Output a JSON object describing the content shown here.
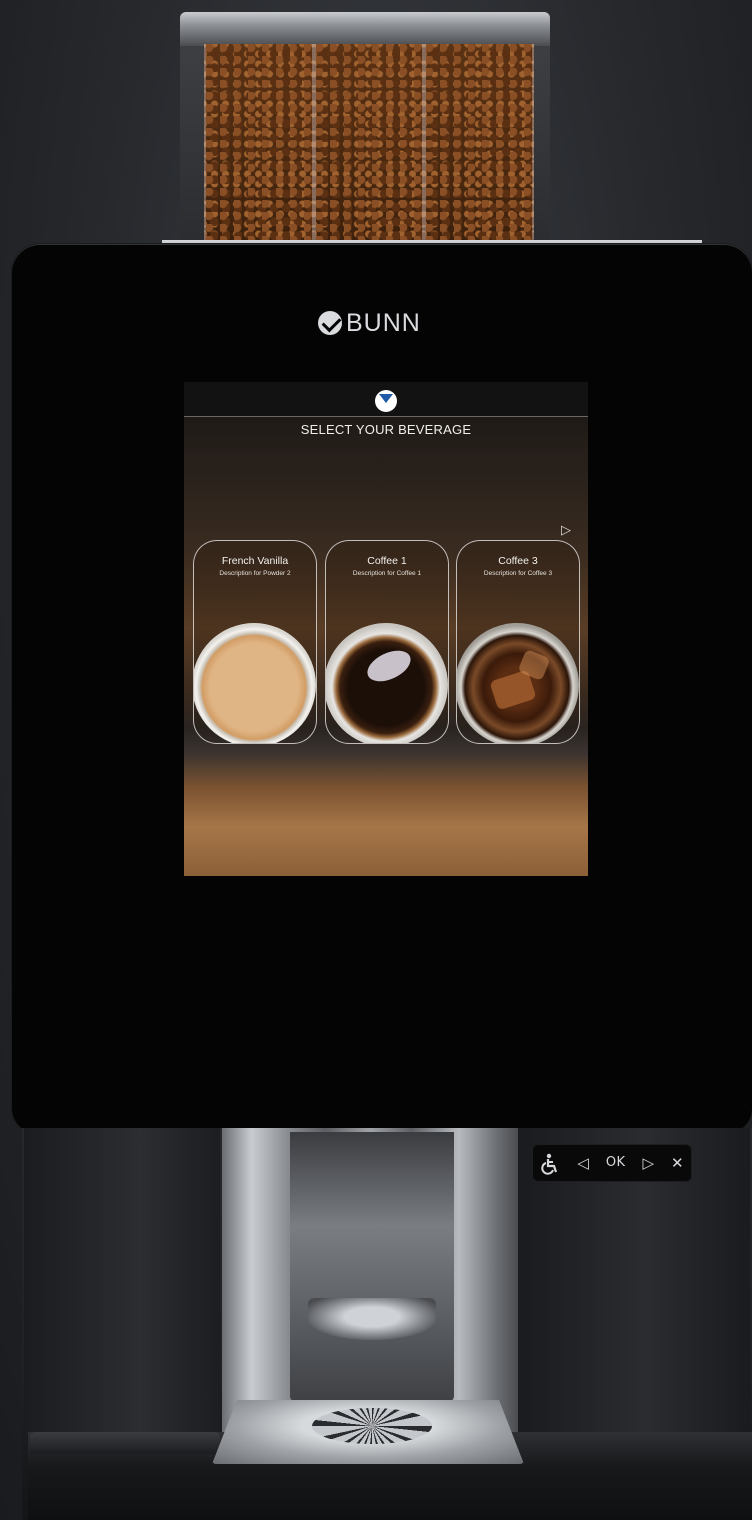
{
  "brand": {
    "name": "BUNN"
  },
  "screen": {
    "title": "SELECT YOUR BEVERAGE",
    "next_icon": "▷",
    "beverages": [
      {
        "name": "French Vanilla",
        "description": "Description for Powder 2",
        "image": "latte-cup"
      },
      {
        "name": "Coffee 1",
        "description": "Description for Coffee 1",
        "image": "black-coffee-cup"
      },
      {
        "name": "Coffee 3",
        "description": "Description for Coffee 3",
        "image": "iced-coffee-cup"
      }
    ]
  },
  "keypad": {
    "accessibility_icon": "wheelchair-icon",
    "prev_label": "◁",
    "ok_label": "OK",
    "next_label": "▷",
    "close_label": "✕"
  },
  "colors": {
    "body": "#040404",
    "screen_logo_accent": "#1f5aa6",
    "text": "#f1efec"
  }
}
